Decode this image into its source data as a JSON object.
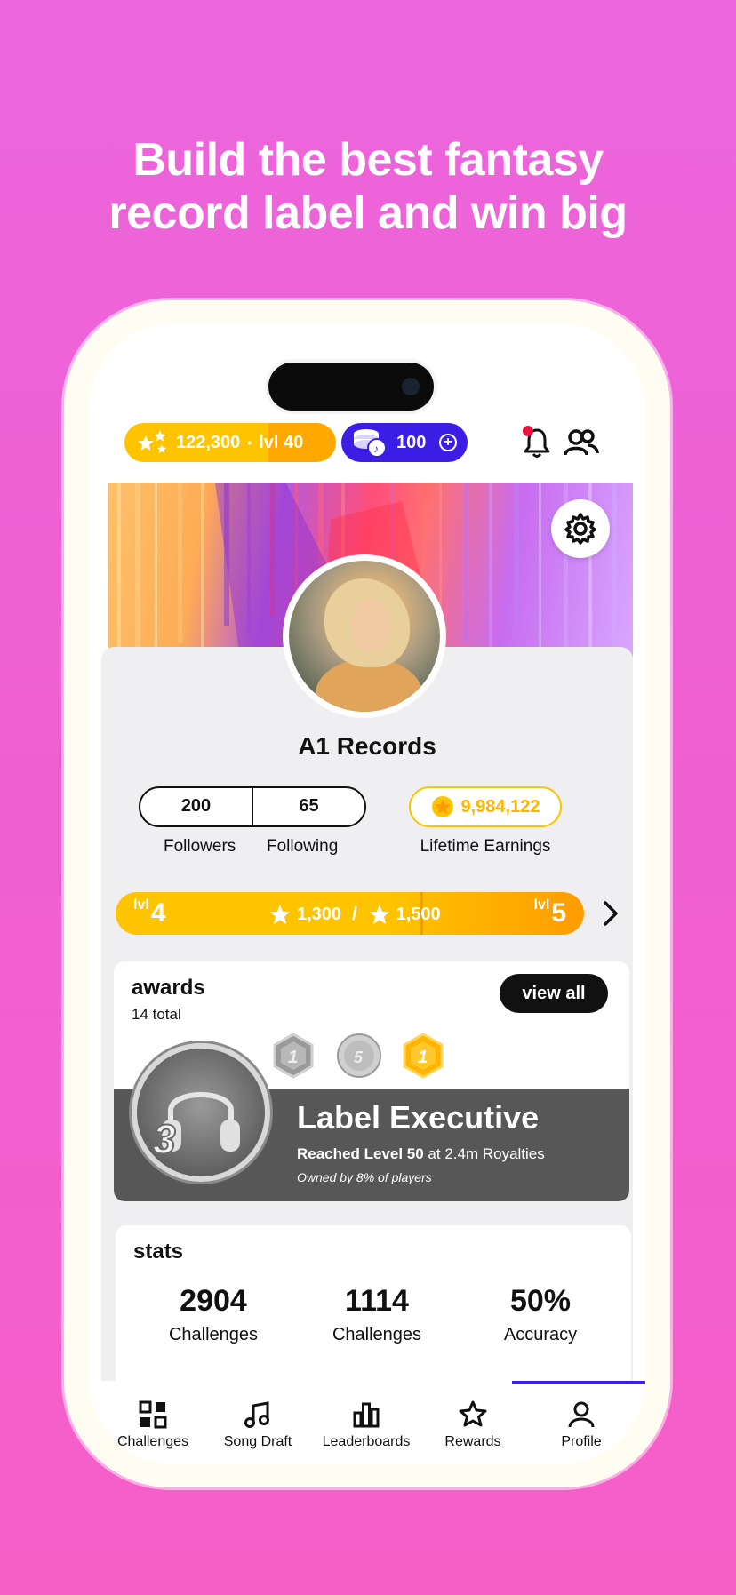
{
  "headline": {
    "line1": "Build the best fantasy",
    "line2": "record label and win big"
  },
  "topbar": {
    "xp_value": "122,300",
    "xp_separator": "•",
    "xp_level": "lvl 40",
    "coins": "100",
    "notification_dot_color": "#e8143c",
    "icons": [
      "stars-icon",
      "coins-icon",
      "plus-circle-icon",
      "bell-icon",
      "friends-icon"
    ]
  },
  "profile": {
    "label_name": "A1 Records",
    "followers_count": "200",
    "followers_label": "Followers",
    "following_count": "65",
    "following_label": "Following",
    "earnings_value": "9,984,122",
    "earnings_label": "Lifetime Earnings"
  },
  "level_progress": {
    "current_level_prefix": "lvl",
    "current_level": "4",
    "current_xp": "1,300",
    "separator": "/",
    "target_xp": "1,500",
    "next_level_prefix": "lvl",
    "next_level": "5",
    "progress_fraction": 0.867
  },
  "awards": {
    "title": "awards",
    "total": "14 total",
    "view_all": "view all",
    "featured": {
      "badge_number": "3",
      "name": "Label Executive",
      "desc_bold": "Reached Level 50",
      "desc_rest": " at 2.4m Royalties",
      "owned": "Owned by 8% of players"
    },
    "mini_badges": [
      {
        "number": "1",
        "tone": "silver-hex"
      },
      {
        "number": "5",
        "tone": "silver-disc"
      },
      {
        "number": "1",
        "tone": "gold-hex"
      }
    ]
  },
  "stats": {
    "title": "stats",
    "items": [
      {
        "value": "2904",
        "label": "Challenges"
      },
      {
        "value": "1114",
        "label": "Challenges"
      },
      {
        "value": "50%",
        "label": "Accuracy"
      }
    ]
  },
  "tabbar": {
    "tabs": [
      {
        "label": "Challenges",
        "icon": "grid-icon"
      },
      {
        "label": "Song Draft",
        "icon": "music-note-icon"
      },
      {
        "label": "Leaderboards",
        "icon": "bar-chart-icon"
      },
      {
        "label": "Rewards",
        "icon": "star-icon"
      },
      {
        "label": "Profile",
        "icon": "user-icon"
      }
    ],
    "active_index": 4
  },
  "colors": {
    "xp_gold": "#ffc400",
    "coin_blue": "#3b1de6",
    "background_pink": "#f05fd2"
  }
}
